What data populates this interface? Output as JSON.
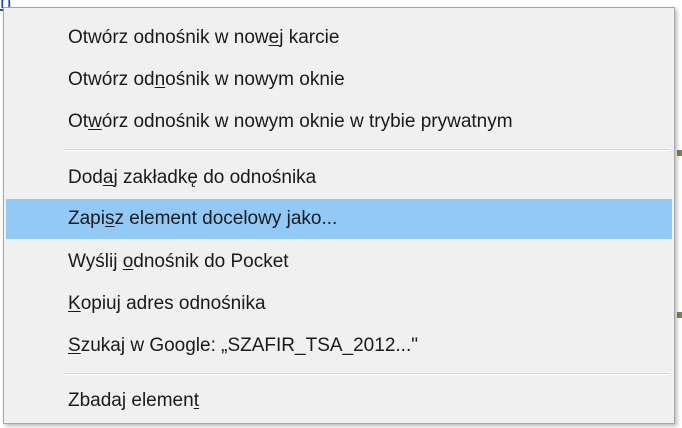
{
  "background": {
    "corner_fragment": "rf"
  },
  "menu": {
    "groups": [
      {
        "items": [
          {
            "id": "open-new-tab",
            "before": "Otwórz odnośnik w now",
            "accel": "e",
            "after": "j karcie",
            "highlighted": false
          },
          {
            "id": "open-new-window",
            "before": "Otwórz od",
            "accel": "n",
            "after": "ośnik w nowym oknie",
            "highlighted": false
          },
          {
            "id": "open-private-window",
            "before": "Ot",
            "accel": "w",
            "after": "órz odnośnik w nowym oknie w trybie prywatnym",
            "highlighted": false
          }
        ]
      },
      {
        "items": [
          {
            "id": "bookmark-link",
            "before": "Dod",
            "accel": "a",
            "after": "j zakładkę do odnośnika",
            "highlighted": false
          },
          {
            "id": "save-link-as",
            "before": "Zapi",
            "accel": "s",
            "after": "z element docelowy jako...",
            "highlighted": true
          },
          {
            "id": "send-to-pocket",
            "before": "Wyślij ",
            "accel": "o",
            "after": "dnośnik do Pocket",
            "highlighted": false
          },
          {
            "id": "copy-link-address",
            "before": "",
            "accel": "K",
            "after": "opiuj adres odnośnika",
            "highlighted": false
          },
          {
            "id": "search-google",
            "before": "",
            "accel": "S",
            "after": "zukaj w Google: „SZAFIR_TSA_2012...\"",
            "highlighted": false
          }
        ]
      },
      {
        "items": [
          {
            "id": "inspect-element",
            "before": "Zbadaj elemen",
            "accel": "t",
            "after": "",
            "highlighted": false
          }
        ]
      }
    ]
  },
  "colors": {
    "menu_background": "#f0f0f0",
    "highlight": "#91c9f7",
    "text": "#1a1a1a",
    "border": "#a7a7a7"
  }
}
